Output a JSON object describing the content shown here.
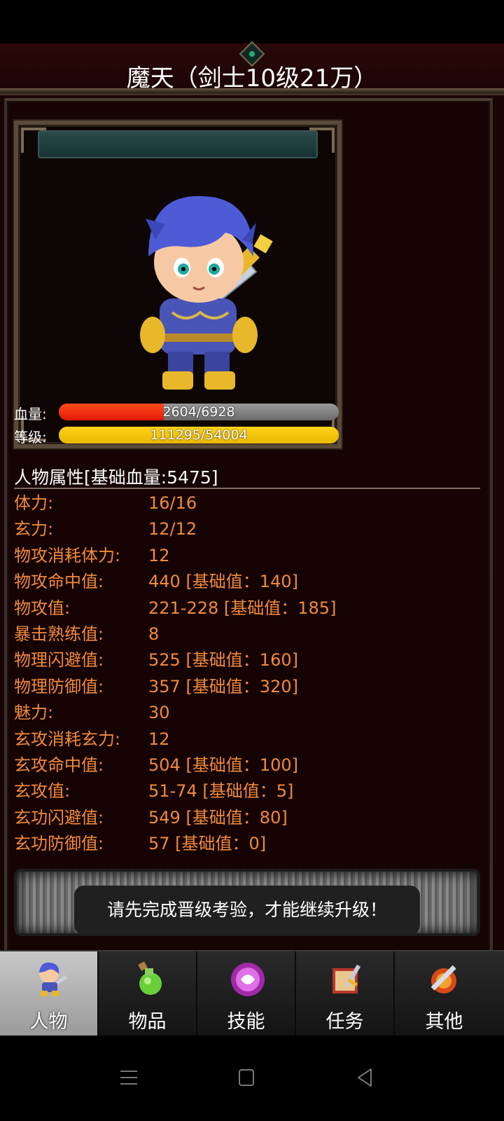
{
  "title": "魔天（剑士10级21万）",
  "stats": {
    "hp_label": "血量:",
    "hp_text": "2604/6928",
    "hp_fraction": 0.376,
    "level_label": "等级:",
    "level_text": "111295/54004",
    "level_fraction": 1.0
  },
  "attributes": {
    "header": "人物属性[基础血量:5475]",
    "rows": [
      {
        "name": "体力:",
        "value": "16/16"
      },
      {
        "name": "玄力:",
        "value": "12/12"
      },
      {
        "name": "物攻消耗体力:",
        "value": "12"
      },
      {
        "name": "物攻命中值:",
        "value": "440 [基础值：140]"
      },
      {
        "name": "物攻值:",
        "value": "221-228 [基础值：185]"
      },
      {
        "name": "暴击熟练值:",
        "value": "8"
      },
      {
        "name": "物理闪避值:",
        "value": "525 [基础值：160]"
      },
      {
        "name": "物理防御值:",
        "value": "357 [基础值：320]"
      },
      {
        "name": "魅力:",
        "value": "30"
      },
      {
        "name": "玄攻消耗玄力:",
        "value": "12"
      },
      {
        "name": "玄攻命中值:",
        "value": "504 [基础值：100]"
      },
      {
        "name": "玄攻值:",
        "value": "51-74 [基础值：5]"
      },
      {
        "name": "玄功闪避值:",
        "value": "549 [基础值：80]"
      },
      {
        "name": "玄功防御值:",
        "value": "57 [基础值：0]"
      }
    ]
  },
  "toast": "请先完成晋级考验，才能继续升级！",
  "nav": {
    "items": [
      {
        "label": "人物",
        "icon": "character-icon"
      },
      {
        "label": "物品",
        "icon": "potion-icon"
      },
      {
        "label": "技能",
        "icon": "skill-orb-icon"
      },
      {
        "label": "任务",
        "icon": "quest-book-icon"
      },
      {
        "label": "其他",
        "icon": "sword-shield-icon"
      }
    ],
    "active": 0
  },
  "colors": {
    "attribute_text": "#f08a3c",
    "hp_bar": "#e01a08",
    "level_bar": "#e8b800"
  }
}
